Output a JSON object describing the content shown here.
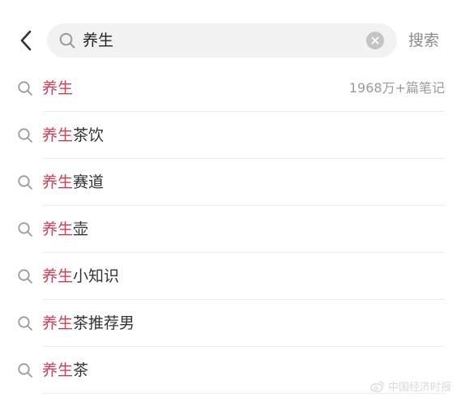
{
  "colors": {
    "highlight": "#d43c54",
    "text": "#333333",
    "muted": "#9a9a9a",
    "search_bg": "#f2f2f2"
  },
  "header": {
    "back_icon": "chevron-left-icon",
    "search": {
      "icon": "search-icon",
      "value": "养生",
      "clear_icon": "clear-icon"
    },
    "submit_label": "搜索"
  },
  "suggestions": [
    {
      "highlight": "养生",
      "rest": "",
      "count": "1968万+篇笔记"
    },
    {
      "highlight": "养生",
      "rest": "茶饮",
      "count": ""
    },
    {
      "highlight": "养生",
      "rest": "赛道",
      "count": ""
    },
    {
      "highlight": "养生",
      "rest": "壶",
      "count": ""
    },
    {
      "highlight": "养生",
      "rest": "小知识",
      "count": ""
    },
    {
      "highlight": "养生",
      "rest": "茶推荐男",
      "count": ""
    },
    {
      "highlight": "养生",
      "rest": "茶",
      "count": ""
    }
  ],
  "watermark": {
    "icon": "weibo-logo-icon",
    "text": "中国经济时报"
  }
}
